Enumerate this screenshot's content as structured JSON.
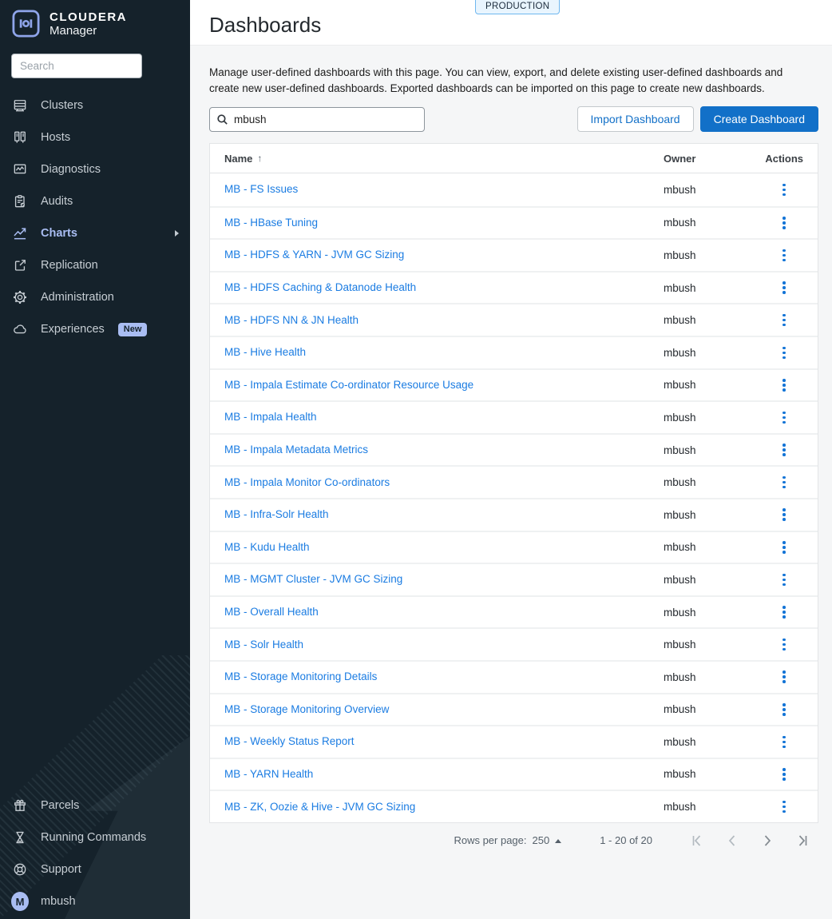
{
  "sidebar": {
    "logo": {
      "brand": "CLOUDERA",
      "product": "Manager"
    },
    "search_placeholder": "Search",
    "items": [
      {
        "label": "Clusters",
        "icon": "clusters-icon"
      },
      {
        "label": "Hosts",
        "icon": "hosts-icon"
      },
      {
        "label": "Diagnostics",
        "icon": "diagnostics-icon"
      },
      {
        "label": "Audits",
        "icon": "audits-icon"
      },
      {
        "label": "Charts",
        "icon": "charts-icon",
        "active": true,
        "has_submenu": true
      },
      {
        "label": "Replication",
        "icon": "replication-icon"
      },
      {
        "label": "Administration",
        "icon": "administration-icon"
      },
      {
        "label": "Experiences",
        "icon": "experiences-icon",
        "badge": "New"
      }
    ],
    "bottom_items": [
      {
        "label": "Parcels",
        "icon": "parcels-icon"
      },
      {
        "label": "Running Commands",
        "icon": "running-commands-icon"
      },
      {
        "label": "Support",
        "icon": "support-icon"
      }
    ],
    "user": {
      "initial": "M",
      "name": "mbush"
    }
  },
  "header": {
    "title": "Dashboards",
    "env_badge": "PRODUCTION"
  },
  "main": {
    "description": "Manage user-defined dashboards with this page. You can view, export, and delete existing user-defined dashboards and create new user-defined dashboards. Exported dashboards can be imported on this page to create new dashboards.",
    "filter_value": "mbush",
    "import_button": "Import Dashboard",
    "create_button": "Create Dashboard"
  },
  "table": {
    "columns": {
      "name": "Name",
      "owner": "Owner",
      "actions": "Actions"
    },
    "sort_indicator": "↑",
    "rows": [
      {
        "name": "MB - FS Issues",
        "owner": "mbush"
      },
      {
        "name": "MB - HBase Tuning",
        "owner": "mbush"
      },
      {
        "name": "MB - HDFS & YARN - JVM GC Sizing",
        "owner": "mbush"
      },
      {
        "name": "MB - HDFS Caching & Datanode Health",
        "owner": "mbush"
      },
      {
        "name": "MB - HDFS NN & JN Health",
        "owner": "mbush"
      },
      {
        "name": "MB - Hive Health",
        "owner": "mbush"
      },
      {
        "name": "MB - Impala Estimate Co-ordinator Resource Usage",
        "owner": "mbush"
      },
      {
        "name": "MB - Impala Health",
        "owner": "mbush"
      },
      {
        "name": "MB - Impala Metadata Metrics",
        "owner": "mbush"
      },
      {
        "name": "MB - Impala Monitor Co-ordinators",
        "owner": "mbush"
      },
      {
        "name": "MB - Infra-Solr Health",
        "owner": "mbush"
      },
      {
        "name": "MB - Kudu Health",
        "owner": "mbush"
      },
      {
        "name": "MB - MGMT Cluster - JVM GC Sizing",
        "owner": "mbush"
      },
      {
        "name": "MB - Overall Health",
        "owner": "mbush"
      },
      {
        "name": "MB - Solr Health",
        "owner": "mbush"
      },
      {
        "name": "MB - Storage Monitoring Details",
        "owner": "mbush"
      },
      {
        "name": "MB - Storage Monitoring Overview",
        "owner": "mbush"
      },
      {
        "name": "MB - Weekly Status Report",
        "owner": "mbush"
      },
      {
        "name": "MB - YARN Health",
        "owner": "mbush"
      },
      {
        "name": "MB - ZK, Oozie & Hive - JVM GC Sizing",
        "owner": "mbush"
      }
    ]
  },
  "pagination": {
    "rows_per_page_label": "Rows per page:",
    "rows_per_page_value": "250",
    "range": "1 - 20 of 20"
  },
  "colors": {
    "sidebar_bg": "#15222b",
    "sidebar_accent": "#a9bdf2",
    "link_blue": "#1b7ce2",
    "button_blue": "#1270c8",
    "env_badge_bg": "#e9f5fe",
    "env_badge_border": "#6fb7ef",
    "content_bg": "#f5f6f7"
  }
}
